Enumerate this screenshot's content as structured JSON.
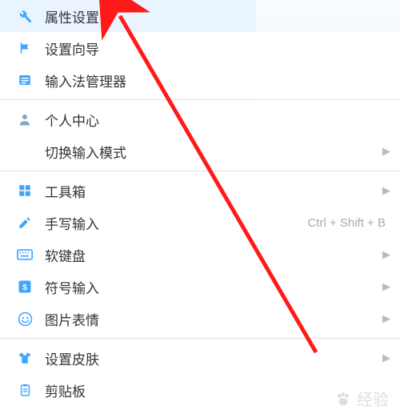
{
  "menu": {
    "groups": [
      [
        {
          "id": "properties",
          "icon": "wrench",
          "label": "属性设置",
          "shortcut": "",
          "submenu": false
        },
        {
          "id": "wizard",
          "icon": "flag",
          "label": "设置向导",
          "shortcut": "",
          "submenu": false
        },
        {
          "id": "ime-manager",
          "icon": "list",
          "label": "输入法管理器",
          "shortcut": "",
          "submenu": false
        }
      ],
      [
        {
          "id": "user-center",
          "icon": "user",
          "label": "个人中心",
          "shortcut": "",
          "submenu": false
        },
        {
          "id": "switch-mode",
          "icon": "",
          "label": "切换输入模式",
          "shortcut": "",
          "submenu": true
        }
      ],
      [
        {
          "id": "toolbox",
          "icon": "grid",
          "label": "工具箱",
          "shortcut": "",
          "submenu": true
        },
        {
          "id": "handwriting",
          "icon": "pencil",
          "label": "手写输入",
          "shortcut": "Ctrl + Shift + B",
          "submenu": false
        },
        {
          "id": "soft-keyboard",
          "icon": "keyboard",
          "label": "软键盘",
          "shortcut": "",
          "submenu": true
        },
        {
          "id": "symbol-input",
          "icon": "symbol",
          "label": "符号输入",
          "shortcut": "",
          "submenu": true
        },
        {
          "id": "emoji",
          "icon": "smile",
          "label": "图片表情",
          "shortcut": "",
          "submenu": true
        }
      ],
      [
        {
          "id": "skin",
          "icon": "shirt",
          "label": "设置皮肤",
          "shortcut": "",
          "submenu": true
        },
        {
          "id": "clipboard",
          "icon": "clipboard",
          "label": "剪贴板",
          "shortcut": "",
          "submenu": false
        }
      ]
    ]
  },
  "colors": {
    "icon": "#3da6ff",
    "iconAlt": "#7da7c9",
    "text": "#333",
    "muted": "#aaa"
  },
  "watermark": {
    "text": "经验"
  }
}
